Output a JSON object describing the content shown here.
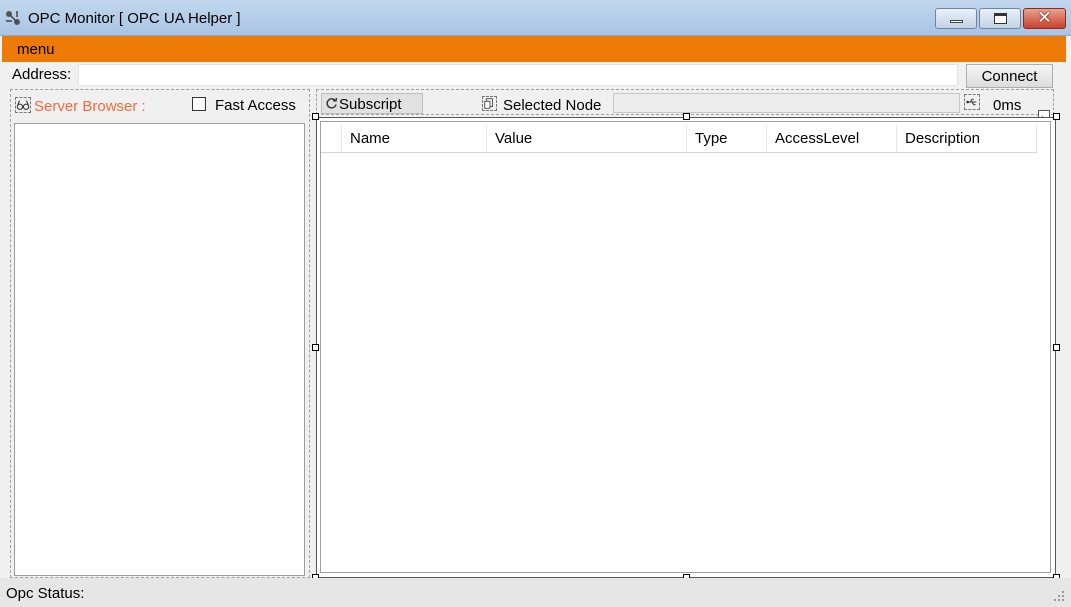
{
  "window": {
    "title": "OPC Monitor [ OPC UA Helper ]",
    "icon": "opc-network-icon"
  },
  "menu": {
    "items": [
      {
        "label": "menu"
      }
    ]
  },
  "address": {
    "label": "Address:",
    "value": "",
    "connect_label": "Connect"
  },
  "left_panel": {
    "server_browser_label": "Server Browser :",
    "server_browser_color": "#f26a3a",
    "fast_access_label": "Fast Access",
    "fast_access_checked": false,
    "icon": "glasses-icon"
  },
  "toolbar": {
    "subscript_label": "Subscript",
    "selected_node_label": "Selected Node",
    "selected_node_value": "",
    "interval_label": "0ms"
  },
  "grid": {
    "columns": [
      "Name",
      "Value",
      "Type",
      "AccessLevel",
      "Description"
    ],
    "rows": []
  },
  "status": {
    "label": "Opc Status:"
  },
  "colors": {
    "menubar": "#ee7a06",
    "titlebar": "#b9d1ea"
  }
}
